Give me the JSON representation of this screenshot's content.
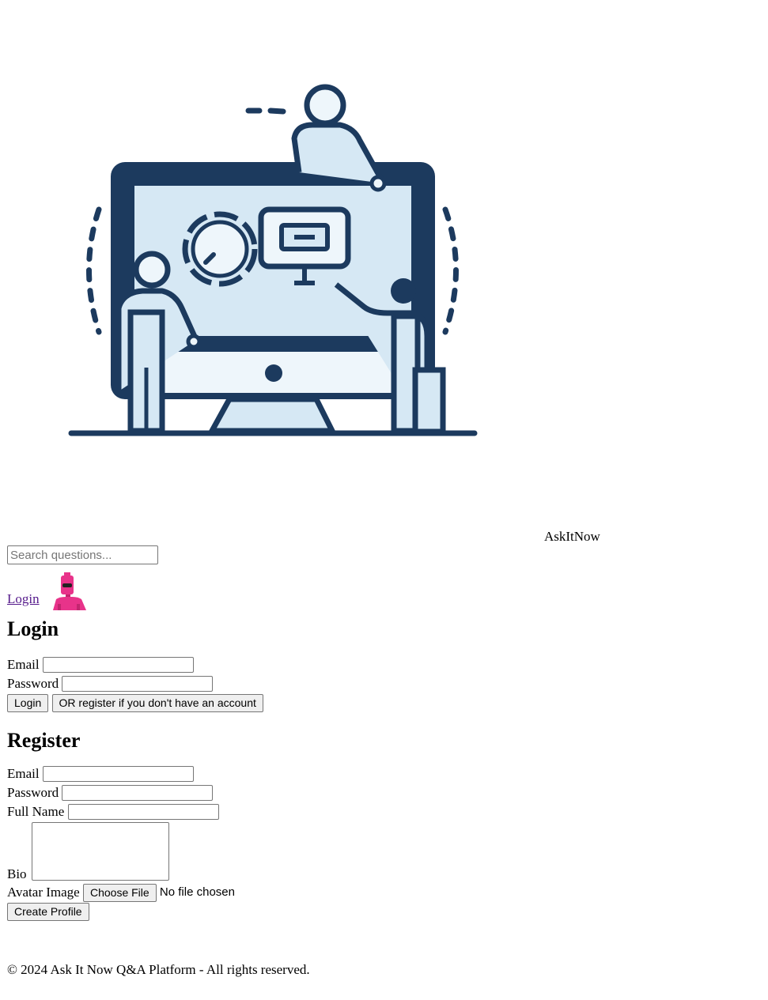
{
  "header": {
    "title": "AskItNow",
    "logo_icon": "people-at-monitor-illustration"
  },
  "search": {
    "placeholder": "Search questions...",
    "value": ""
  },
  "nav": {
    "login_link": "Login",
    "avatar_icon": "pink-robot-avatar"
  },
  "login": {
    "heading": "Login",
    "email_label": "Email",
    "password_label": "Password",
    "submit_label": "Login",
    "register_switch_label": "OR register if you don't have an account"
  },
  "register": {
    "heading": "Register",
    "email_label": "Email",
    "password_label": "Password",
    "fullname_label": "Full Name",
    "bio_label": "Bio",
    "avatar_label": "Avatar Image",
    "choose_file_label": "Choose File",
    "no_file_text": "No file chosen",
    "submit_label": "Create Profile"
  },
  "footer": {
    "text": "© 2024 Ask It Now Q&A Platform - All rights reserved."
  },
  "colors": {
    "illustration_dark": "#1c3a5e",
    "illustration_light": "#d6e8f4",
    "avatar_pink": "#e8338a",
    "link_visited": "#551a8b"
  }
}
